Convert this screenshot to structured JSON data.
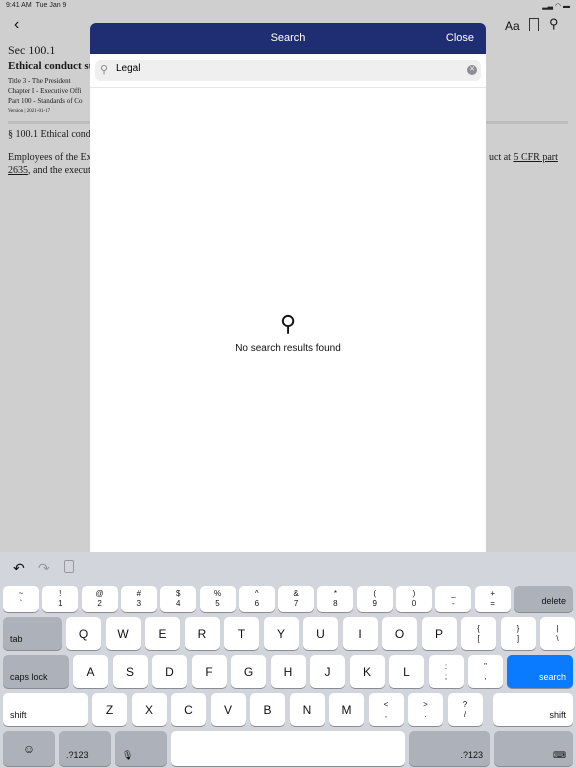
{
  "status": {
    "time": "9:41 AM",
    "date": "Tue Jan 9"
  },
  "nav": {
    "title": "Sec 100.1",
    "font_icon": "Aa"
  },
  "doc": {
    "section": "Sec 100.1",
    "heading": "Ethical conduct st",
    "title": "Title 3 - The President",
    "chapter": "Chapter I - Executive Offi",
    "part": "Part 100 - Standards of Co",
    "version": "Version | 2021-01-17",
    "para_title": "§ 100.1 Ethical cond",
    "body1": "Employees of the Ex",
    "body1_end": "uct at ",
    "link1": "5 CFR part",
    "link2": "2635",
    "body2": ", and the execut"
  },
  "modal": {
    "title": "Search",
    "close": "Close",
    "query": "Legal",
    "empty": "No search results found",
    "header_color": "#1f2d73"
  },
  "keyboard": {
    "rows": [
      [
        [
          "~",
          "`"
        ],
        [
          "!",
          "1"
        ],
        [
          "@",
          "2"
        ],
        [
          "#",
          "3"
        ],
        [
          "$",
          "4"
        ],
        [
          "%",
          "5"
        ],
        [
          "^",
          "6"
        ],
        [
          "&",
          "7"
        ],
        [
          "*",
          "8"
        ],
        [
          "(",
          "9"
        ],
        [
          ")",
          "0"
        ],
        [
          "_",
          "-"
        ],
        [
          "+",
          "="
        ]
      ],
      [
        "Q",
        "W",
        "E",
        "R",
        "T",
        "Y",
        "U",
        "I",
        "O",
        "P",
        [
          "{",
          "["
        ],
        [
          "}",
          "]"
        ],
        [
          "|",
          "\\"
        ]
      ],
      [
        "A",
        "S",
        "D",
        "F",
        "G",
        "H",
        "J",
        "K",
        "L",
        [
          ":",
          ";"
        ],
        [
          "\"",
          ","
        ]
      ],
      [
        "Z",
        "X",
        "C",
        "V",
        "B",
        "N",
        "M",
        [
          "<",
          ","
        ],
        [
          ">",
          "."
        ],
        [
          "?",
          "/"
        ]
      ]
    ],
    "delete": "delete",
    "tab": "tab",
    "caps": "caps lock",
    "search": "search",
    "shift": "shift",
    "num": ".?123",
    "accent": "#0a7aff"
  }
}
